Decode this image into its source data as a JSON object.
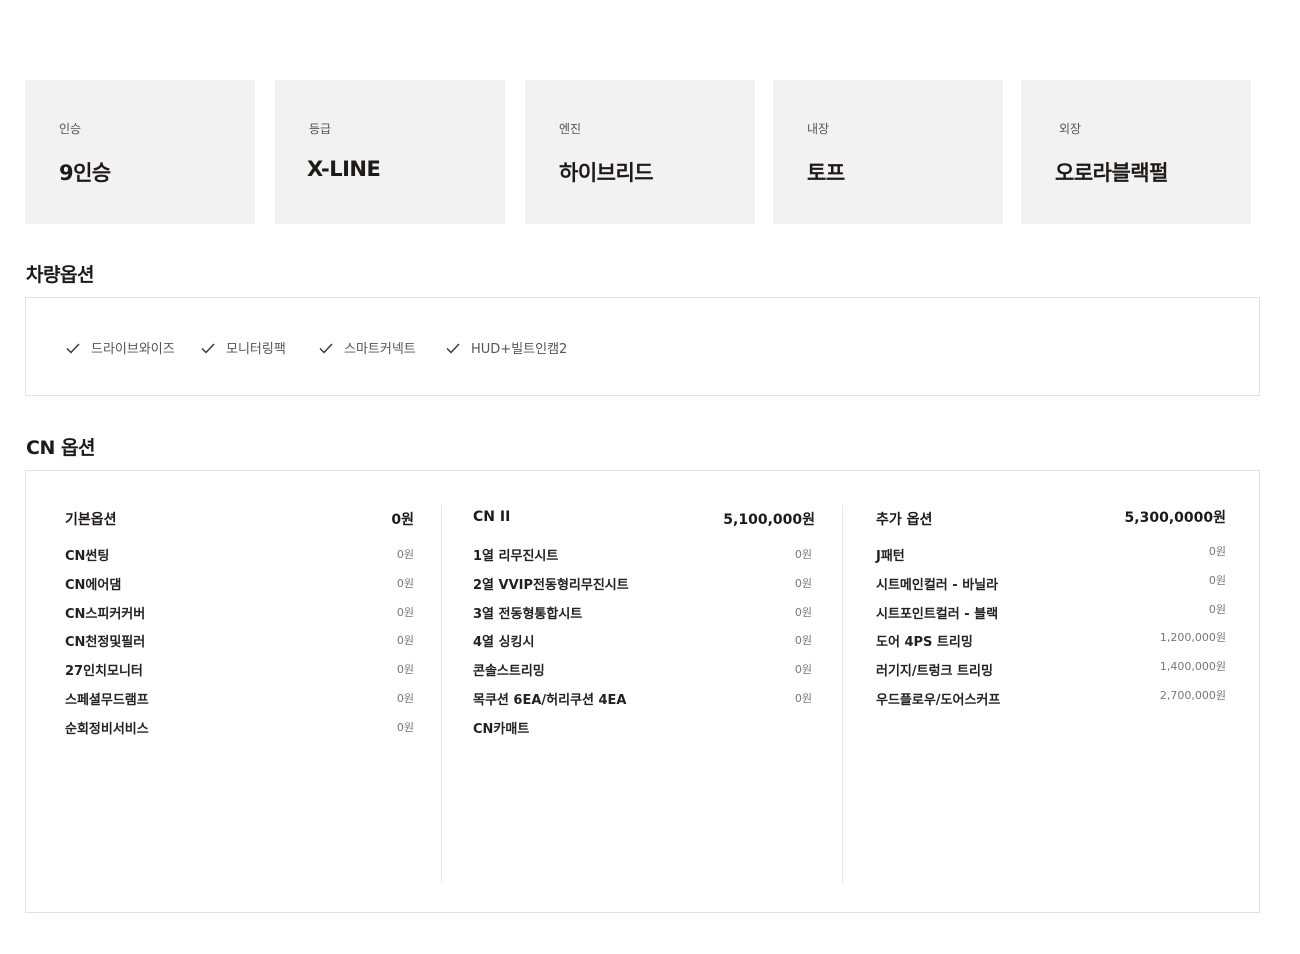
{
  "specs": [
    {
      "label": "인승",
      "value": "9인승"
    },
    {
      "label": "등급",
      "value": "X-LINE"
    },
    {
      "label": "엔진",
      "value": "하이브리드"
    },
    {
      "label": "내장",
      "value": "토프"
    },
    {
      "label": "외장",
      "value": "오로라블랙펄"
    }
  ],
  "vehicle_options": {
    "title": "차량옵션",
    "items": [
      "드라이브와이즈",
      "모니터링팩",
      "스마트커넥트",
      "HUD+빌트인캠2"
    ],
    "check_icon": "check-icon"
  },
  "cn_options": {
    "title": "CN 옵션",
    "columns": [
      {
        "title": "기본옵션",
        "price": "0원",
        "rows": [
          {
            "name": "CN썬팅",
            "price": "0원"
          },
          {
            "name": "CN에어댐",
            "price": "0원"
          },
          {
            "name": "CN스피커커버",
            "price": "0원"
          },
          {
            "name": "CN천정및필러",
            "price": "0원"
          },
          {
            "name": "27인치모니터",
            "price": "0원"
          },
          {
            "name": "스페셜무드램프",
            "price": "0원"
          },
          {
            "name": "순회정비서비스",
            "price": "0원"
          }
        ]
      },
      {
        "title": "CN II",
        "price": "5,100,000원",
        "rows": [
          {
            "name": "1열 리무진시트",
            "price": "0원"
          },
          {
            "name": "2열 VVIP전동형리무진시트",
            "price": "0원"
          },
          {
            "name": "3열 전동형통합시트",
            "price": "0원"
          },
          {
            "name": "4열 싱킹시",
            "price": "0원"
          },
          {
            "name": "콘솔스트리밍",
            "price": "0원"
          },
          {
            "name": "목쿠션 6EA/허리쿠션 4EA",
            "price": "0원"
          },
          {
            "name": "CN카매트",
            "price": ""
          }
        ]
      },
      {
        "title": "추가 옵션",
        "price": "5,300,0000원",
        "rows": [
          {
            "name": "J패턴",
            "price": "0원"
          },
          {
            "name": "시트메인컬러 - 바닐라",
            "price": "0원"
          },
          {
            "name": "시트포인트컬러 - 블랙",
            "price": "0원"
          },
          {
            "name": "도어 4PS 트리밍",
            "price": "1,200,000원"
          },
          {
            "name": "러기지/트렁크 트리밍",
            "price": "1,400,000원"
          },
          {
            "name": "우드플로우/도어스커프",
            "price": "2,700,000원"
          }
        ]
      }
    ]
  }
}
